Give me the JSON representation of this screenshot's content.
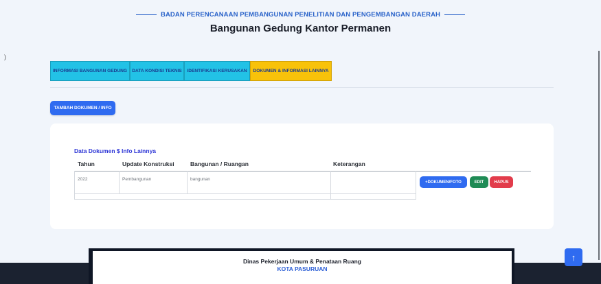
{
  "header": {
    "subtitle": "BADAN PERENCANAAN PEMBANGUNAN PENELITIAN DAN PENGEMBANGAN DAERAH",
    "title": "Bangunan Gedung Kantor Permanen",
    "left_mark": ")"
  },
  "tabs": [
    {
      "label": "INFORMASI BANGUNAN GEDUNG",
      "active": false
    },
    {
      "label": "DATA KONDISI TEKNIS",
      "active": false
    },
    {
      "label": "IDENTIFIKASI KERUSAKAN",
      "active": false
    },
    {
      "label": "DOKUMEN & INFORMASI LAINNYA",
      "active": true
    }
  ],
  "add_button": "TAMBAH DOKUMEN / INFO",
  "table": {
    "title": "Data Dokumen $ Info Lainnya",
    "headers": [
      "Tahun",
      "Update Konstruksi",
      "Bangunan / Ruangan",
      "Keterangan"
    ],
    "rows": [
      {
        "tahun": "2022",
        "update": "Pembangunan",
        "bangunan": "bangunan",
        "keterangan": ""
      }
    ],
    "actions": {
      "doc": "+DOKUMEN/FOTO",
      "edit": "EDIT",
      "delete": "HAPUS"
    }
  },
  "footer": {
    "line1": "Dinas Pekerjaan Umum & Penataan Ruang",
    "line2": "KOTA PASURUAN"
  },
  "back_to_top": "↑",
  "colors": {
    "accent": "#2f6bf0",
    "tab": "#22c2e6",
    "tab_active": "#f8c20a",
    "edit": "#1f8b55",
    "delete": "#e23c4b"
  }
}
